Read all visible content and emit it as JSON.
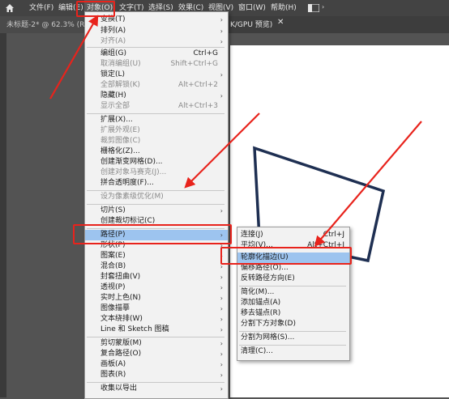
{
  "menubar": {
    "items": [
      "文件(F)",
      "编辑(E)",
      "对象(O)",
      "文字(T)",
      "选择(S)",
      "效果(C)",
      "视图(V)",
      "窗口(W)",
      "帮助(H)"
    ]
  },
  "tab": {
    "title": "未标题-2* @ 62.3% (RG",
    "title_right": "K/GPU 预览)",
    "close": "✕"
  },
  "object_menu": [
    {
      "label": "变换(T)",
      "arrow": true,
      "enabled": true
    },
    {
      "label": "排列(A)",
      "arrow": true,
      "enabled": true
    },
    {
      "label": "对齐(A)",
      "arrow": true,
      "enabled": false
    },
    {
      "label": "编组(G)",
      "shortcut": "Ctrl+G",
      "enabled": true
    },
    {
      "label": "取消编组(U)",
      "shortcut": "Shift+Ctrl+G",
      "enabled": false
    },
    {
      "label": "锁定(L)",
      "arrow": true,
      "enabled": true
    },
    {
      "label": "全部解锁(K)",
      "shortcut": "Alt+Ctrl+2",
      "enabled": false
    },
    {
      "label": "隐藏(H)",
      "arrow": true,
      "enabled": true
    },
    {
      "label": "显示全部",
      "shortcut": "Alt+Ctrl+3",
      "enabled": false
    },
    {
      "label": "扩展(X)...",
      "enabled": true
    },
    {
      "label": "扩展外观(E)",
      "enabled": false
    },
    {
      "label": "裁剪图像(C)",
      "enabled": false
    },
    {
      "label": "栅格化(Z)...",
      "enabled": true
    },
    {
      "label": "创建渐变网格(D)...",
      "enabled": true
    },
    {
      "label": "创建对象马赛克(J)...",
      "enabled": false
    },
    {
      "label": "拼合透明度(F)...",
      "enabled": true
    },
    {
      "label": "设为像素级优化(M)",
      "enabled": false
    },
    {
      "label": "切片(S)",
      "arrow": true,
      "enabled": true
    },
    {
      "label": "创建裁切标记(C)",
      "enabled": true
    },
    {
      "label": "路径(P)",
      "arrow": true,
      "enabled": true,
      "highlighted": true
    },
    {
      "label": "形状(P)",
      "arrow": true,
      "enabled": true
    },
    {
      "label": "图案(E)",
      "arrow": true,
      "enabled": true
    },
    {
      "label": "混合(B)",
      "arrow": true,
      "enabled": true
    },
    {
      "label": "封套扭曲(V)",
      "arrow": true,
      "enabled": true
    },
    {
      "label": "透视(P)",
      "arrow": true,
      "enabled": true
    },
    {
      "label": "实时上色(N)",
      "arrow": true,
      "enabled": true
    },
    {
      "label": "图像描摹",
      "arrow": true,
      "enabled": true
    },
    {
      "label": "文本绕排(W)",
      "arrow": true,
      "enabled": true
    },
    {
      "label": "Line 和 Sketch 图稿",
      "arrow": true,
      "enabled": true
    },
    {
      "label": "剪切蒙版(M)",
      "arrow": true,
      "enabled": true
    },
    {
      "label": "复合路径(O)",
      "arrow": true,
      "enabled": true
    },
    {
      "label": "画板(A)",
      "arrow": true,
      "enabled": true
    },
    {
      "label": "图表(R)",
      "arrow": true,
      "enabled": true
    },
    {
      "label": "收集以导出",
      "arrow": true,
      "enabled": true
    }
  ],
  "path_submenu": [
    {
      "label": "连接(J)",
      "shortcut": "Ctrl+J"
    },
    {
      "label": "平均(V)...",
      "shortcut": "Alt+Ctrl+J"
    },
    {
      "label": "轮廓化描边(U)",
      "highlighted": true
    },
    {
      "label": "偏移路径(O)..."
    },
    {
      "label": "反转路径方向(E)"
    },
    {
      "label": "简化(M)..."
    },
    {
      "label": "添加锚点(A)"
    },
    {
      "label": "移去锚点(R)"
    },
    {
      "label": "分割下方对象(D)"
    },
    {
      "label": "分割为网格(S)..."
    },
    {
      "label": "清理(C)..."
    }
  ],
  "colors": {
    "highlight": "#9dc4ef",
    "annotation": "#e8231c",
    "shape_stroke": "#1e2f52"
  },
  "icons": [
    "home-icon",
    "workspace-icon",
    "chevron-right-icon"
  ]
}
